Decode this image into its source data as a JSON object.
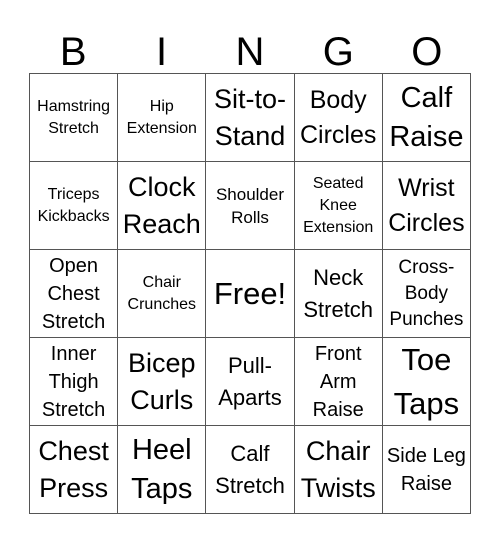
{
  "header": {
    "letters": [
      "B",
      "I",
      "N",
      "G",
      "O"
    ]
  },
  "cells": [
    [
      "Hamstring Stretch",
      "Hip Extension",
      "Sit-to- Stand",
      "Body Circles",
      "Calf Raise"
    ],
    [
      "Triceps Kickbacks",
      "Clock Reach",
      "Shoulder Rolls",
      "Seated Knee Extension",
      "Wrist Circles"
    ],
    [
      "Open Chest Stretch",
      "Chair Crunches",
      "Free!",
      "Neck Stretch",
      "Cross- Body Punches"
    ],
    [
      "Inner Thigh Stretch",
      "Bicep Curls",
      "Pull- Aparts",
      "Front Arm Raise",
      "Toe Taps"
    ],
    [
      "Chest Press",
      "Heel Taps",
      "Calf Stretch",
      "Chair Twists",
      "Side Leg Raise"
    ]
  ]
}
